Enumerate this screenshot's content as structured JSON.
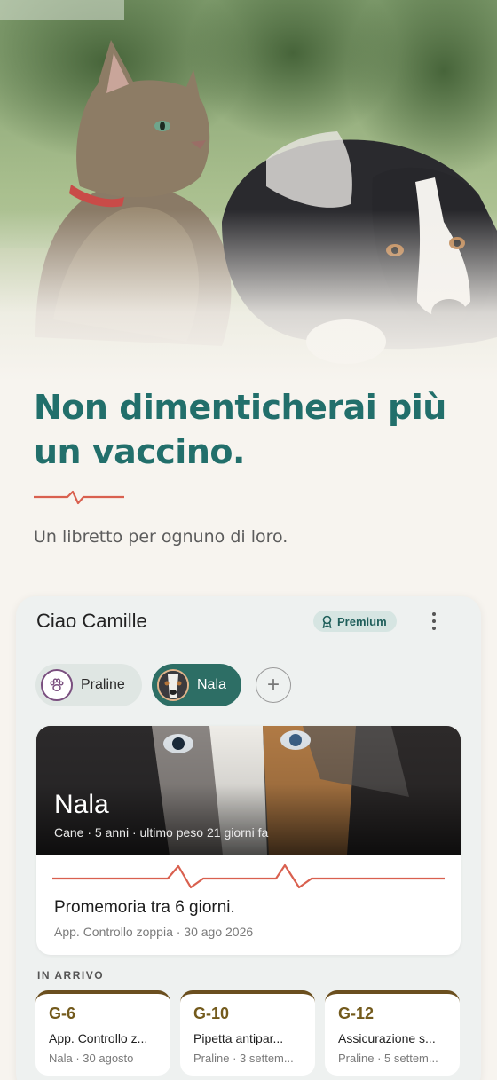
{
  "hero": {
    "headline": "Non dimenticherai più un vaccino.",
    "subtitle": "Un libretto per ognuno di loro."
  },
  "app": {
    "greeting": "Ciao Camille",
    "premium_label": "Premium",
    "pets": [
      {
        "name": "Praline",
        "icon": "paw-icon"
      },
      {
        "name": "Nala",
        "icon": "dog-photo"
      }
    ],
    "add_pet_label": "+",
    "featured": {
      "name": "Nala",
      "meta": "Cane · 5 anni · ultimo peso 21 giorni fa",
      "reminder_title": "Promemoria tra 6 giorni.",
      "reminder_sub": "App. Controllo zoppia · 30 ago 2026"
    },
    "upcoming_label": "IN ARRIVO",
    "upcoming": [
      {
        "countdown": "G-6",
        "title": "App. Controllo z...",
        "sub": "Nala · 30 agosto"
      },
      {
        "countdown": "G-10",
        "title": "Pipetta antipar...",
        "sub": "Praline · 3 settem..."
      },
      {
        "countdown": "G-12",
        "title": "Assicurazione s...",
        "sub": "Praline · 5 settem..."
      }
    ]
  },
  "colors": {
    "brand_teal": "#226f6b",
    "accent_red": "#d9604f",
    "countdown_brown": "#735a1c",
    "background": "#f7f4ef"
  }
}
